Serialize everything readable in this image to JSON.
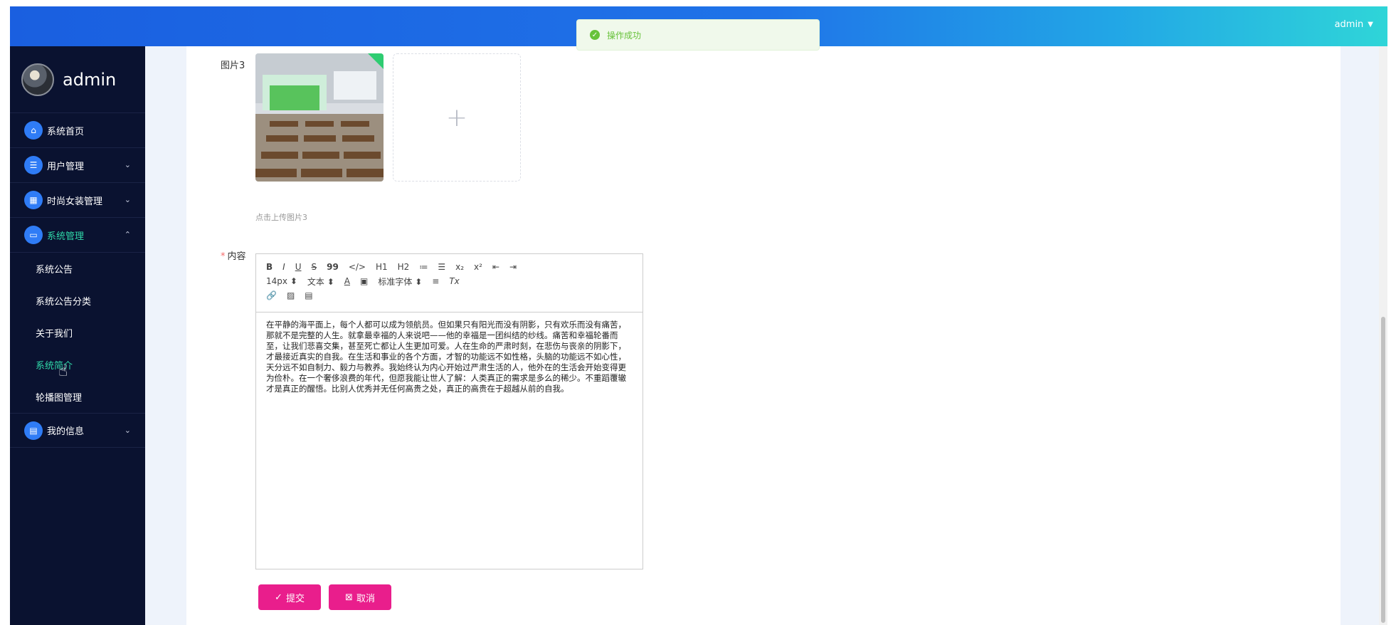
{
  "header": {
    "admin_label": "admin",
    "caret": "▼"
  },
  "toast": {
    "text": "操作成功"
  },
  "sidebar": {
    "username": "admin",
    "items": [
      {
        "label": "系统首页",
        "icon": "home-icon"
      },
      {
        "label": "用户管理",
        "icon": "list-icon"
      },
      {
        "label": "时尚女装管理",
        "icon": "grid-icon"
      },
      {
        "label": "系统管理",
        "icon": "monitor-icon"
      },
      {
        "label": "我的信息",
        "icon": "card-icon"
      }
    ],
    "sub_items": [
      {
        "label": "系统公告"
      },
      {
        "label": "系统公告分类"
      },
      {
        "label": "关于我们"
      },
      {
        "label": "系统简介"
      },
      {
        "label": "轮播图管理"
      }
    ]
  },
  "form": {
    "image3_label": "图片3",
    "upload_plus": "+",
    "image3_tip": "点击上传图片3",
    "content_label": "内容",
    "required_mark": "*",
    "toolbar": {
      "row1": [
        "B",
        "I",
        "U",
        "S",
        "99",
        "</>",
        "H1",
        "H2",
        "≔",
        "☰",
        "x₂",
        "x²",
        "⇤",
        "⇥"
      ],
      "font_size": "14px",
      "text_type": "文本",
      "font_family": "标准字体",
      "select_arrow": "⬍"
    },
    "content_text": "在平静的海平面上，每个人都可以成为领航员。但如果只有阳光而没有阴影，只有欢乐而没有痛苦，那就不是完整的人生。就拿最幸福的人来说吧——他的幸福是一团纠结的纱线。痛苦和幸福轮番而至，让我们悲喜交集，甚至死亡都让人生更加可爱。人在生命的严肃时刻，在悲伤与丧亲的阴影下，才最接近真实的自我。在生活和事业的各个方面，才智的功能远不如性格，头脑的功能远不如心性，天分远不如自制力、毅力与教养。我始终认为内心开始过严肃生活的人，他外在的生活会开始变得更为俭朴。在一个奢侈浪费的年代，但愿我能让世人了解：人类真正的需求是多么的稀少。不重蹈覆辙才是真正的醒悟。比别人优秀并无任何高贵之处，真正的高贵在于超越从前的自我。"
  },
  "buttons": {
    "submit": "提交",
    "cancel": "取消"
  }
}
